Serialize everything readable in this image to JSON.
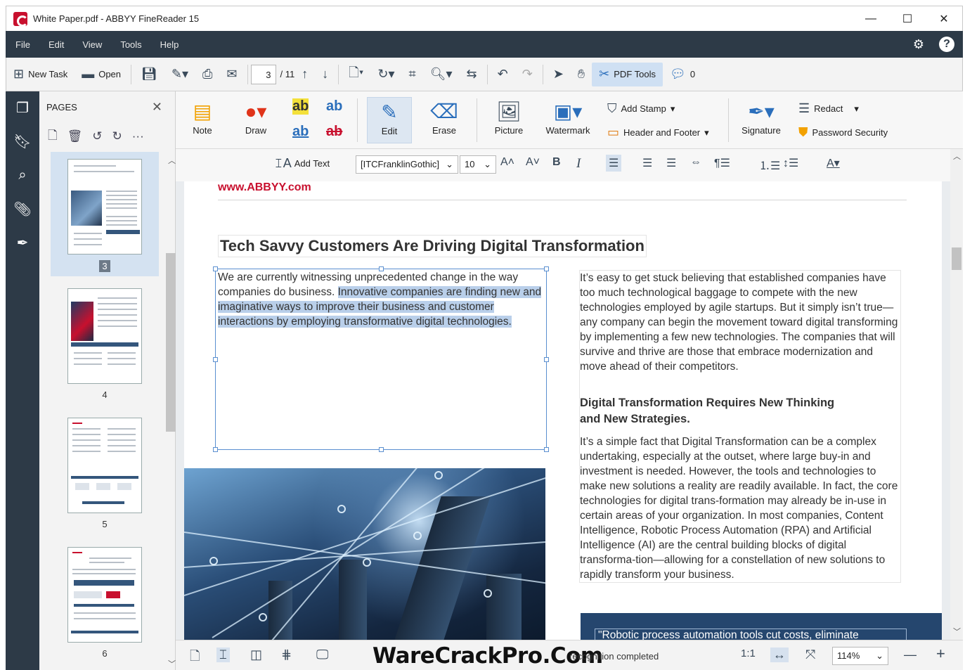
{
  "window": {
    "title": "White Paper.pdf - ABBYY FineReader 15",
    "controls": {
      "minimize": "—",
      "maximize": "☐",
      "close": "✕"
    }
  },
  "menu": {
    "items": [
      "File",
      "Edit",
      "View",
      "Tools",
      "Help"
    ],
    "settings_icon": "⚙",
    "help_icon": "?"
  },
  "toolbar": {
    "new_task": "New Task",
    "open": "Open",
    "page_current": "3",
    "page_total": "/ 11",
    "pdf_tools": "PDF Tools",
    "comments_count": "0"
  },
  "pages_panel": {
    "title": "PAGES",
    "close": "✕",
    "more": "···",
    "thumbnails": [
      {
        "number": "3",
        "selected": true
      },
      {
        "number": "4",
        "selected": false
      },
      {
        "number": "5",
        "selected": false
      },
      {
        "number": "6",
        "selected": false
      }
    ]
  },
  "ribbon": {
    "note": "Note",
    "draw": "Draw",
    "ab": "ab",
    "edit": "Edit",
    "erase": "Erase",
    "picture": "Picture",
    "watermark": "Watermark",
    "add_stamp": "Add Stamp",
    "header_footer": "Header and Footer",
    "signature": "Signature",
    "redact": "Redact",
    "password_security": "Password Security"
  },
  "format": {
    "add_text": "Add Text",
    "font": "[ITCFranklinGothic]",
    "size": "10",
    "bold": "B",
    "italic": "I"
  },
  "document": {
    "url": "www.ABBYY.com",
    "title": "Tech Savvy Customers Are Driving Digital Transformation",
    "left_col_plain": "We are currently witnessing unprecedented change in the way companies do business. ",
    "left_col_selected": "Innovative companies are finding new and imaginative ways to improve their business and customer interactions by employing transformative digital technologies.",
    "right_para1": "It’s easy to get stuck believing that established companies have too much technological baggage to compete with the new technologies employed by agile startups. But it simply isn’t true—any company can begin the movement toward digital transforming by implementing a few new technologies. The companies that will survive and thrive are those that embrace modernization and move ahead of their competitors.",
    "subheading_line1": "Digital Transformation Requires New Thinking",
    "subheading_line2": "and New Strategies.",
    "right_para2": "It’s a simple fact that Digital Transformation can be a complex undertaking, especially at the outset, where large buy-in and investment is needed. However, the tools and technologies to make new solutions a reality are readily available. In fact, the core technologies for digital trans-formation may already be in-use in certain areas of your organization. In most companies, Content Intelligence, Robotic Process Automation (RPA) and Artificial Intelligence (AI) are the central building blocks of digital transforma-tion—allowing for a constellation of new solutions to rapidly transform your business.",
    "callout": "\"Robotic process automation tools cut costs, eliminate"
  },
  "status": {
    "watermark": "WareCrackPro.Com",
    "recognition": "recognition completed",
    "ratio": "1:1",
    "zoom": "114%",
    "zoom_out": "—",
    "zoom_in": "+"
  },
  "colors": {
    "dark": "#2d3a47",
    "accent_red": "#c8102e",
    "selection": "#b9cfea",
    "callout_bg": "#25466e"
  }
}
